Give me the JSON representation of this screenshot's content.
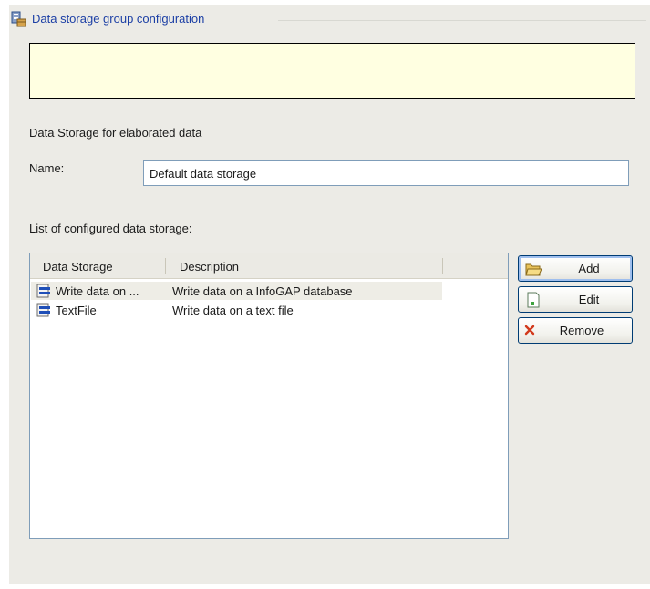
{
  "group": {
    "title": "Data storage group configuration",
    "icon": "database-icon"
  },
  "info_box": {
    "text": ""
  },
  "section": {
    "label": "Data Storage for elaborated data"
  },
  "name_field": {
    "label": "Name:",
    "value": "Default data storage"
  },
  "list": {
    "label": "List of configured data storage:",
    "columns": [
      "Data Storage",
      "Description"
    ],
    "rows": [
      {
        "name": "Write data on ...",
        "description": "Write data on a InfoGAP database",
        "selected": true,
        "icon": "database-table-icon"
      },
      {
        "name": "TextFile",
        "description": "Write data on a text file",
        "selected": false,
        "icon": "database-table-icon"
      }
    ]
  },
  "buttons": {
    "add": {
      "label": "Add",
      "icon": "folder-open-icon"
    },
    "edit": {
      "label": "Edit",
      "icon": "document-edit-icon"
    },
    "remove": {
      "label": "Remove",
      "icon": "red-x-icon"
    }
  },
  "colors": {
    "title_blue": "#1c3fa5",
    "info_bg": "#ffffe1",
    "panel_bg": "#ecebe6",
    "border_blue": "#7f9db9"
  }
}
